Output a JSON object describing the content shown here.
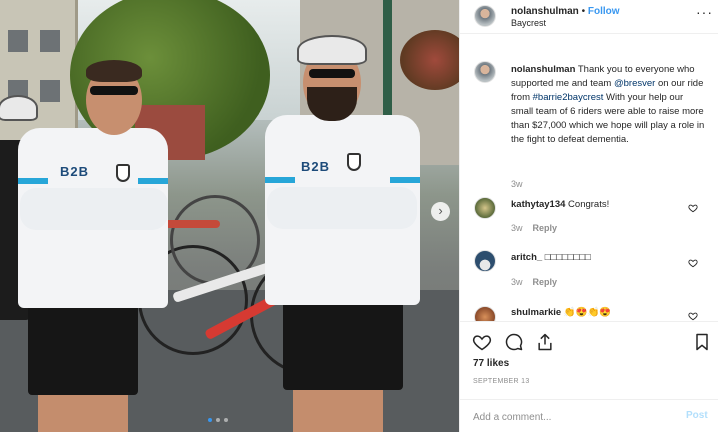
{
  "post": {
    "author": "nolanshulman",
    "separator": "•",
    "follow_label": "Follow",
    "location": "Baycrest",
    "more_label": "···"
  },
  "caption": {
    "username": "nolanshulman",
    "text_before": " Thank you to everyone who supported me and team ",
    "mention": "@bresver",
    "text_middle": " on our ride from ",
    "hashtag": "#barrie2baycrest",
    "text_after": " With your help our small team of 6 riders were able to raise more than $27,000 which we hope will play a role in the fight to defeat dementia.",
    "age": "3w"
  },
  "comments": [
    {
      "username": "kathytay134",
      "text": " Congrats!",
      "age": "3w",
      "reply_label": "Reply"
    },
    {
      "username": "aritch_",
      "text": " □□□□□□□□",
      "age": "3w",
      "reply_label": "Reply"
    },
    {
      "username": "shulmarkie",
      "text": " 👏😍👏😍",
      "age": "",
      "reply_label": ""
    }
  ],
  "engagement": {
    "likes": "77 likes",
    "date": "SEPTEMBER 13"
  },
  "composer": {
    "placeholder": "Add a comment...",
    "post_label": "Post"
  },
  "photo": {
    "next_arrow": "›",
    "jersey_logo": "B2B"
  },
  "colors": {
    "accent": "#3897f0",
    "muted": "#8e8e8e",
    "post_disabled": "#b2dffc"
  }
}
